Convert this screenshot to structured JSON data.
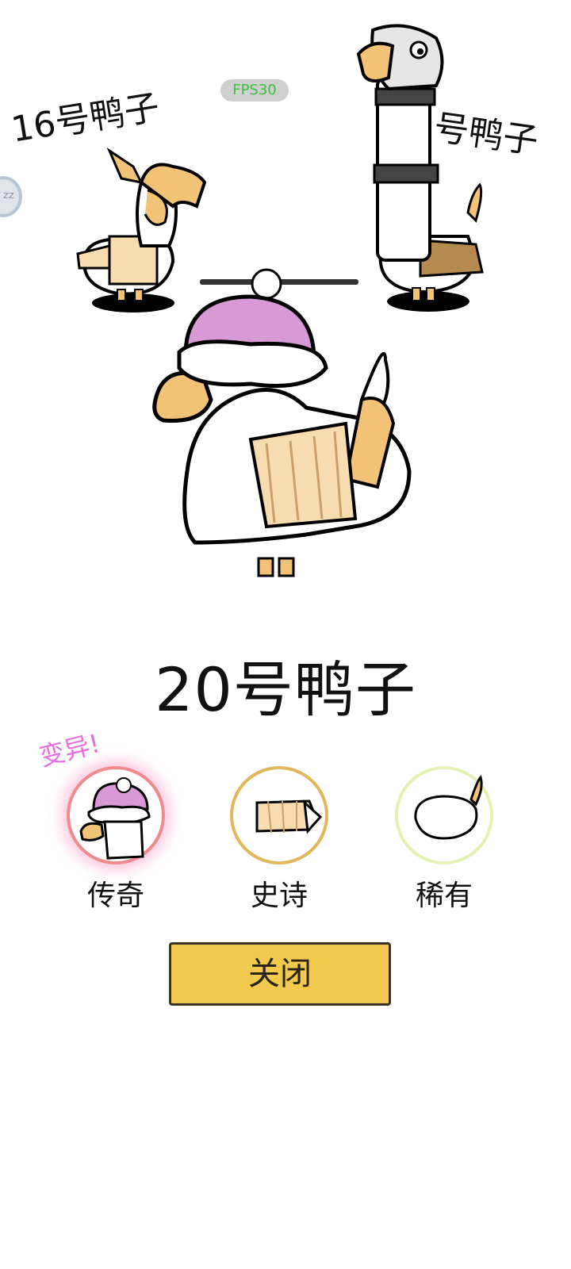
{
  "hud": {
    "fps_label": "FPS30"
  },
  "neighbors": {
    "left_label": "16号鸭子",
    "right_label": "号鸭子"
  },
  "current_duck": {
    "name": "20号鸭子",
    "mutation_tag": "变异!"
  },
  "parts": [
    {
      "rarity": "传奇",
      "part": "hat",
      "ring_color": "#f08b8b"
    },
    {
      "rarity": "史诗",
      "part": "scarf",
      "ring_color": "#e0b75a"
    },
    {
      "rarity": "稀有",
      "part": "body",
      "ring_color": "#e3f2b4"
    }
  ],
  "buttons": {
    "close_label": "关闭"
  },
  "colors": {
    "button_fill": "#f1c94c",
    "hat_pink": "#d89ad6",
    "beak_orange": "#f2c277",
    "scarf_cream": "#f6dcae"
  }
}
